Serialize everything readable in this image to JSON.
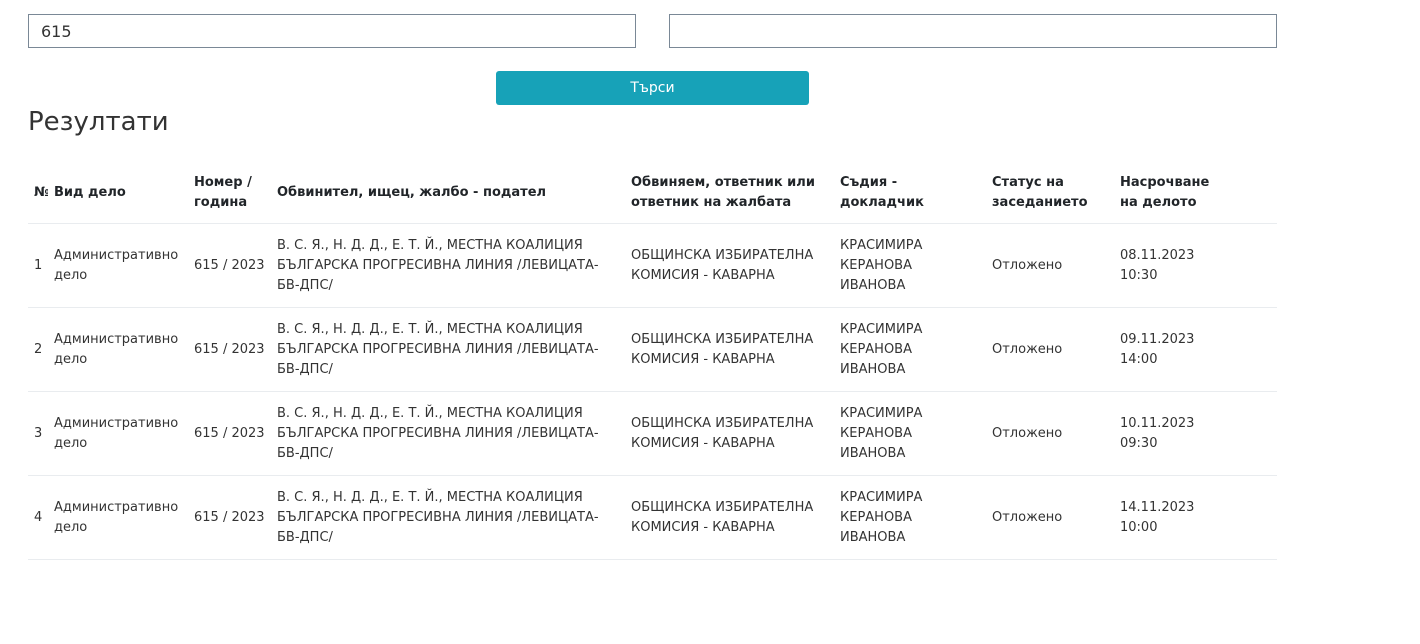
{
  "search_form": {
    "case_number": {
      "label": "",
      "value": "615"
    },
    "case_year": {
      "label": "",
      "value": ""
    },
    "search_button_label": "Търси"
  },
  "results": {
    "title": "Резултати",
    "columns": [
      "№",
      "Вид дело",
      "Номер / година",
      "Обвинител, ищец, жалбо - подател",
      "Обвиняем, ответник или ответник на жалбата",
      "Съдия - докладчик",
      "Статус на заседанието",
      "Насрочване на делото",
      ""
    ],
    "rows": [
      {
        "num": "1",
        "case_type": "Административно дело",
        "number_year": "615 / 2023",
        "plaintiff": "В. С. Я., Н. Д. Д., Е. Т. Й., МЕСТНА КОАЛИЦИЯ БЪЛГАРСКА ПРОГРЕСИВНА ЛИНИЯ /ЛЕВИЦАТА-БВ-ДПС/",
        "defendant": "ОБЩИНСКА ИЗБИРАТЕЛНА КОМИСИЯ - КАВАРНА",
        "judge": "КРАСИМИРА КЕРАНОВА ИВАНОВА",
        "status": "Отложено",
        "scheduled": "08.11.2023 10:30",
        "hall": ""
      },
      {
        "num": "2",
        "case_type": "Административно дело",
        "number_year": "615 / 2023",
        "plaintiff": "В. С. Я., Н. Д. Д., Е. Т. Й., МЕСТНА КОАЛИЦИЯ БЪЛГАРСКА ПРОГРЕСИВНА ЛИНИЯ /ЛЕВИЦАТА-БВ-ДПС/",
        "defendant": "ОБЩИНСКА ИЗБИРАТЕЛНА КОМИСИЯ - КАВАРНА",
        "judge": "КРАСИМИРА КЕРАНОВА ИВАНОВА",
        "status": "Отложено",
        "scheduled": "09.11.2023 14:00",
        "hall": ""
      },
      {
        "num": "3",
        "case_type": "Административно дело",
        "number_year": "615 / 2023",
        "plaintiff": "В. С. Я., Н. Д. Д., Е. Т. Й., МЕСТНА КОАЛИЦИЯ БЪЛГАРСКА ПРОГРЕСИВНА ЛИНИЯ /ЛЕВИЦАТА-БВ-ДПС/",
        "defendant": "ОБЩИНСКА ИЗБИРАТЕЛНА КОМИСИЯ - КАВАРНА",
        "judge": "КРАСИМИРА КЕРАНОВА ИВАНОВА",
        "status": "Отложено",
        "scheduled": "10.11.2023 09:30",
        "hall": ""
      },
      {
        "num": "4",
        "case_type": "Административно дело",
        "number_year": "615 / 2023",
        "plaintiff": "В. С. Я., Н. Д. Д., Е. Т. Й., МЕСТНА КОАЛИЦИЯ БЪЛГАРСКА ПРОГРЕСИВНА ЛИНИЯ /ЛЕВИЦАТА-БВ-ДПС/",
        "defendant": "ОБЩИНСКА ИЗБИРАТЕЛНА КОМИСИЯ - КАВАРНА",
        "judge": "КРАСИМИРА КЕРАНОВА ИВАНОВА",
        "status": "Отложено",
        "scheduled": "14.11.2023 10:00",
        "hall": ""
      }
    ]
  },
  "colors": {
    "primary_button": "#17a2b8",
    "input_border": "#7a8896",
    "row_divider": "#e9ecef"
  }
}
